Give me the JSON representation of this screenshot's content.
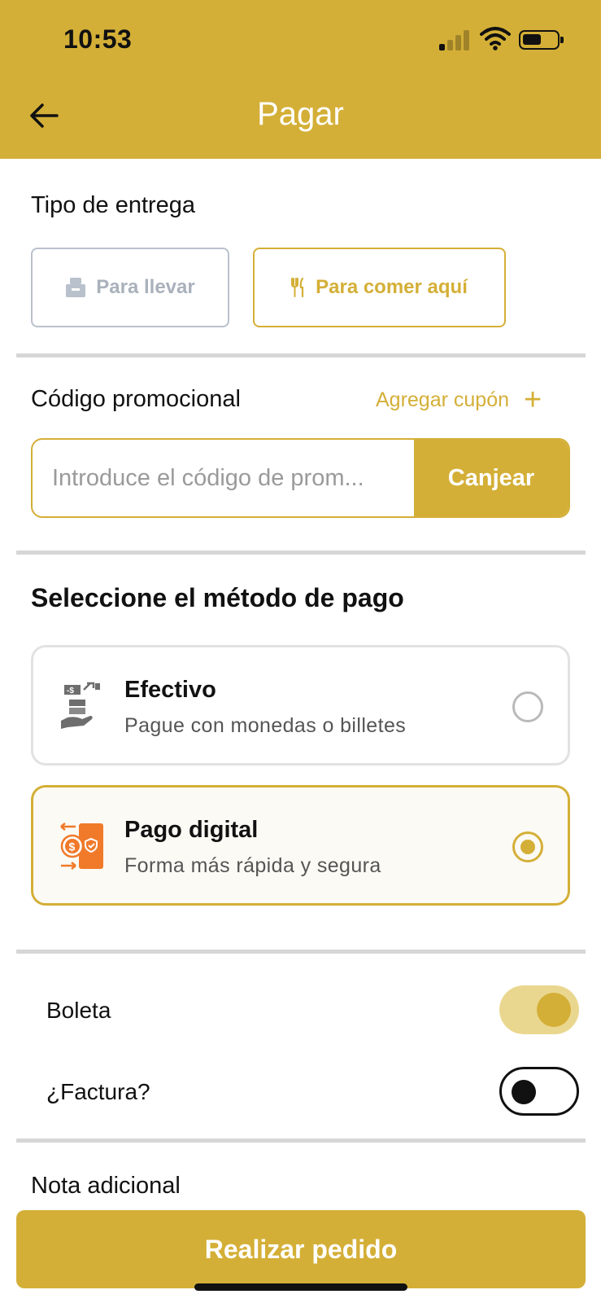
{
  "status_bar": {
    "time": "10:53",
    "signal_bars": 4,
    "signal_active": 1,
    "battery_level": 0.55
  },
  "header": {
    "title": "Pagar",
    "back_icon": "arrow-left-icon"
  },
  "delivery": {
    "label": "Tipo de entrega",
    "options": [
      {
        "label": "Para llevar",
        "icon": "takeaway-bag-icon",
        "selected": false
      },
      {
        "label": "Para comer aquí",
        "icon": "fork-knife-icon",
        "selected": true
      }
    ]
  },
  "promo": {
    "label": "Código promocional",
    "add_coupon": "Agregar cupón",
    "add_icon": "plus-icon",
    "placeholder": "Introduce el código de prom...",
    "value": "",
    "redeem": "Canjear"
  },
  "payment": {
    "heading": "Seleccione el método de pago",
    "methods": [
      {
        "title": "Efectivo",
        "subtitle": "Pague con monedas o billetes",
        "icon": "cash-hand-icon",
        "selected": false
      },
      {
        "title": "Pago digital",
        "subtitle": "Forma más rápida y segura",
        "icon": "digital-payment-icon",
        "selected": true
      }
    ]
  },
  "invoice": {
    "boleta_label": "Boleta",
    "boleta_on": true,
    "factura_label": "¿Factura?",
    "factura_on": false
  },
  "note": {
    "label": "Nota adicional"
  },
  "actions": {
    "place_order": "Realizar pedido"
  },
  "colors": {
    "primary": "#d4af37",
    "primary_light": "#ead78f",
    "divider": "#d6d6d6",
    "orange": "#f07a2a"
  }
}
